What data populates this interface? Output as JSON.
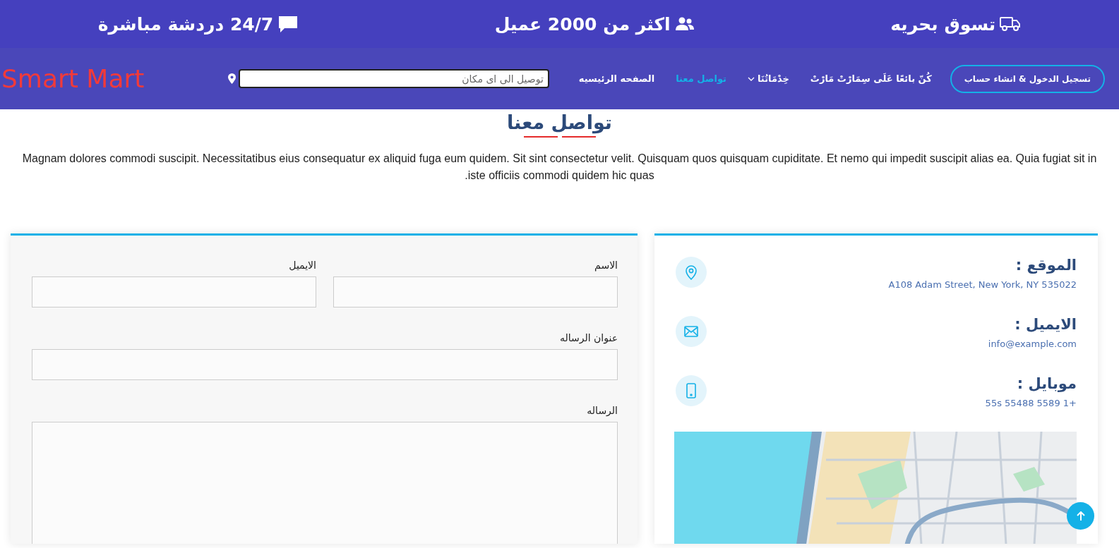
{
  "top_bar": {
    "items": [
      {
        "kind": "truck",
        "text": "تسوق بحريه"
      },
      {
        "kind": "users",
        "text": "اكثر من 2000 عميل"
      },
      {
        "kind": "chat",
        "text": "24/7 دردشة مباشرة"
      }
    ]
  },
  "nav": {
    "login_button": "تسجيل الدخول & انشاء حساب",
    "links": [
      {
        "kind": "link",
        "label": "كُنّ بائعًا عَلَى سِمَارْتْ مَارْتْ",
        "selected": false
      },
      {
        "kind": "dropdown",
        "label": "خِدْمَاتُنَا",
        "selected": false
      },
      {
        "kind": "link",
        "label": "تواصل معنا",
        "selected": true
      },
      {
        "kind": "link",
        "label": "الصفحه الرئيسيه",
        "selected": false
      }
    ],
    "search": {
      "placeholder": "توصيل الى اى مكان"
    },
    "logo": "Smart Mart"
  },
  "contact": {
    "heading": "تواصل معنا",
    "intro": "Magnam dolores commodi suscipit. Necessitatibus eius consequatur ex aliquid fuga eum quidem. Sit sint consectetur velit. Quisquam quos quisquam cupiditate. Et nemo qui impedit suscipit alias ea. Quia fugiat sit in iste officiis commodi quidem hic quas.",
    "info": [
      {
        "kind": "location",
        "title": "الموقع :",
        "value": "A108 Adam Street, New York, NY 535022"
      },
      {
        "kind": "email",
        "title": "الايميل :",
        "value": "info@example.com"
      },
      {
        "kind": "phone",
        "title": "موبايل :",
        "value": "+1 5589 55488 55s"
      }
    ],
    "form": {
      "fields": [
        {
          "kind": "input",
          "label": "الاسم"
        },
        {
          "kind": "input",
          "label": "الايميل"
        },
        {
          "kind": "input",
          "label": "عنوان الرساله",
          "wide": true
        },
        {
          "kind": "textarea",
          "label": "الرساله",
          "wide": true
        }
      ]
    }
  }
}
